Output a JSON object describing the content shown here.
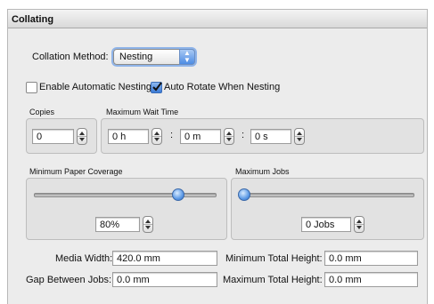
{
  "panel": {
    "title": "Collating"
  },
  "collation": {
    "label": "Collation Method:",
    "selected": "Nesting"
  },
  "checkboxes": {
    "enable_automatic_nesting": {
      "label": "Enable Automatic Nesting",
      "checked": false
    },
    "auto_rotate": {
      "label": "Auto Rotate When Nesting",
      "checked": true
    }
  },
  "copies": {
    "label": "Copies",
    "value": "0"
  },
  "max_wait": {
    "label": "Maximum Wait Time",
    "hours": "0 h",
    "minutes": "0 m",
    "seconds": "0 s",
    "separator": ":"
  },
  "min_paper_coverage": {
    "label": "Minimum Paper Coverage",
    "value": "80%",
    "fraction": 0.8
  },
  "max_jobs": {
    "label": "Maximum Jobs",
    "value": "0 Jobs",
    "fraction": 0.0
  },
  "media_width": {
    "label": "Media Width:",
    "value": "420.0 mm"
  },
  "gap_between_jobs": {
    "label": "Gap Between Jobs:",
    "value": "0.0 mm"
  },
  "min_total_height": {
    "label": "Minimum Total Height:",
    "value": "0.0 mm"
  },
  "max_total_height": {
    "label": "Maximum Total Height:",
    "value": "0.0 mm"
  },
  "colors": {
    "accent": "#4d8ce4",
    "panel_bg": "#ececec",
    "group_bg": "#e2e2e2"
  }
}
